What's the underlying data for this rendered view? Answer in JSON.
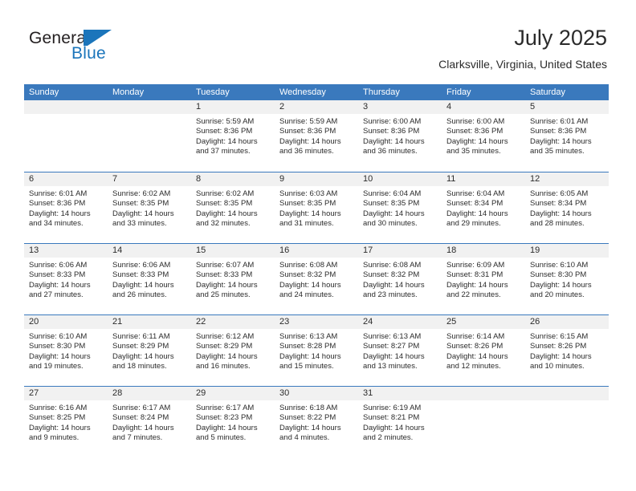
{
  "brand": {
    "word1": "General",
    "word2": "Blue",
    "mark": "flag-triangle-logo"
  },
  "header": {
    "month_title": "July 2025",
    "location": "Clarksville, Virginia, United States"
  },
  "colors": {
    "header_blue": "#3a79bd",
    "brand_blue": "#1b75bb",
    "date_band": "#f1f1f1",
    "text": "#2b2b2b"
  },
  "weekday_headers": [
    "Sunday",
    "Monday",
    "Tuesday",
    "Wednesday",
    "Thursday",
    "Friday",
    "Saturday"
  ],
  "weeks": [
    [
      {
        "date": "",
        "sunrise": "",
        "sunset": "",
        "daylight1": "",
        "daylight2": "",
        "empty": true
      },
      {
        "date": "",
        "sunrise": "",
        "sunset": "",
        "daylight1": "",
        "daylight2": "",
        "empty": true
      },
      {
        "date": "1",
        "sunrise": "Sunrise: 5:59 AM",
        "sunset": "Sunset: 8:36 PM",
        "daylight1": "Daylight: 14 hours",
        "daylight2": "and 37 minutes."
      },
      {
        "date": "2",
        "sunrise": "Sunrise: 5:59 AM",
        "sunset": "Sunset: 8:36 PM",
        "daylight1": "Daylight: 14 hours",
        "daylight2": "and 36 minutes."
      },
      {
        "date": "3",
        "sunrise": "Sunrise: 6:00 AM",
        "sunset": "Sunset: 8:36 PM",
        "daylight1": "Daylight: 14 hours",
        "daylight2": "and 36 minutes."
      },
      {
        "date": "4",
        "sunrise": "Sunrise: 6:00 AM",
        "sunset": "Sunset: 8:36 PM",
        "daylight1": "Daylight: 14 hours",
        "daylight2": "and 35 minutes."
      },
      {
        "date": "5",
        "sunrise": "Sunrise: 6:01 AM",
        "sunset": "Sunset: 8:36 PM",
        "daylight1": "Daylight: 14 hours",
        "daylight2": "and 35 minutes."
      }
    ],
    [
      {
        "date": "6",
        "sunrise": "Sunrise: 6:01 AM",
        "sunset": "Sunset: 8:36 PM",
        "daylight1": "Daylight: 14 hours",
        "daylight2": "and 34 minutes."
      },
      {
        "date": "7",
        "sunrise": "Sunrise: 6:02 AM",
        "sunset": "Sunset: 8:35 PM",
        "daylight1": "Daylight: 14 hours",
        "daylight2": "and 33 minutes."
      },
      {
        "date": "8",
        "sunrise": "Sunrise: 6:02 AM",
        "sunset": "Sunset: 8:35 PM",
        "daylight1": "Daylight: 14 hours",
        "daylight2": "and 32 minutes."
      },
      {
        "date": "9",
        "sunrise": "Sunrise: 6:03 AM",
        "sunset": "Sunset: 8:35 PM",
        "daylight1": "Daylight: 14 hours",
        "daylight2": "and 31 minutes."
      },
      {
        "date": "10",
        "sunrise": "Sunrise: 6:04 AM",
        "sunset": "Sunset: 8:35 PM",
        "daylight1": "Daylight: 14 hours",
        "daylight2": "and 30 minutes."
      },
      {
        "date": "11",
        "sunrise": "Sunrise: 6:04 AM",
        "sunset": "Sunset: 8:34 PM",
        "daylight1": "Daylight: 14 hours",
        "daylight2": "and 29 minutes."
      },
      {
        "date": "12",
        "sunrise": "Sunrise: 6:05 AM",
        "sunset": "Sunset: 8:34 PM",
        "daylight1": "Daylight: 14 hours",
        "daylight2": "and 28 minutes."
      }
    ],
    [
      {
        "date": "13",
        "sunrise": "Sunrise: 6:06 AM",
        "sunset": "Sunset: 8:33 PM",
        "daylight1": "Daylight: 14 hours",
        "daylight2": "and 27 minutes."
      },
      {
        "date": "14",
        "sunrise": "Sunrise: 6:06 AM",
        "sunset": "Sunset: 8:33 PM",
        "daylight1": "Daylight: 14 hours",
        "daylight2": "and 26 minutes."
      },
      {
        "date": "15",
        "sunrise": "Sunrise: 6:07 AM",
        "sunset": "Sunset: 8:33 PM",
        "daylight1": "Daylight: 14 hours",
        "daylight2": "and 25 minutes."
      },
      {
        "date": "16",
        "sunrise": "Sunrise: 6:08 AM",
        "sunset": "Sunset: 8:32 PM",
        "daylight1": "Daylight: 14 hours",
        "daylight2": "and 24 minutes."
      },
      {
        "date": "17",
        "sunrise": "Sunrise: 6:08 AM",
        "sunset": "Sunset: 8:32 PM",
        "daylight1": "Daylight: 14 hours",
        "daylight2": "and 23 minutes."
      },
      {
        "date": "18",
        "sunrise": "Sunrise: 6:09 AM",
        "sunset": "Sunset: 8:31 PM",
        "daylight1": "Daylight: 14 hours",
        "daylight2": "and 22 minutes."
      },
      {
        "date": "19",
        "sunrise": "Sunrise: 6:10 AM",
        "sunset": "Sunset: 8:30 PM",
        "daylight1": "Daylight: 14 hours",
        "daylight2": "and 20 minutes."
      }
    ],
    [
      {
        "date": "20",
        "sunrise": "Sunrise: 6:10 AM",
        "sunset": "Sunset: 8:30 PM",
        "daylight1": "Daylight: 14 hours",
        "daylight2": "and 19 minutes."
      },
      {
        "date": "21",
        "sunrise": "Sunrise: 6:11 AM",
        "sunset": "Sunset: 8:29 PM",
        "daylight1": "Daylight: 14 hours",
        "daylight2": "and 18 minutes."
      },
      {
        "date": "22",
        "sunrise": "Sunrise: 6:12 AM",
        "sunset": "Sunset: 8:29 PM",
        "daylight1": "Daylight: 14 hours",
        "daylight2": "and 16 minutes."
      },
      {
        "date": "23",
        "sunrise": "Sunrise: 6:13 AM",
        "sunset": "Sunset: 8:28 PM",
        "daylight1": "Daylight: 14 hours",
        "daylight2": "and 15 minutes."
      },
      {
        "date": "24",
        "sunrise": "Sunrise: 6:13 AM",
        "sunset": "Sunset: 8:27 PM",
        "daylight1": "Daylight: 14 hours",
        "daylight2": "and 13 minutes."
      },
      {
        "date": "25",
        "sunrise": "Sunrise: 6:14 AM",
        "sunset": "Sunset: 8:26 PM",
        "daylight1": "Daylight: 14 hours",
        "daylight2": "and 12 minutes."
      },
      {
        "date": "26",
        "sunrise": "Sunrise: 6:15 AM",
        "sunset": "Sunset: 8:26 PM",
        "daylight1": "Daylight: 14 hours",
        "daylight2": "and 10 minutes."
      }
    ],
    [
      {
        "date": "27",
        "sunrise": "Sunrise: 6:16 AM",
        "sunset": "Sunset: 8:25 PM",
        "daylight1": "Daylight: 14 hours",
        "daylight2": "and 9 minutes."
      },
      {
        "date": "28",
        "sunrise": "Sunrise: 6:17 AM",
        "sunset": "Sunset: 8:24 PM",
        "daylight1": "Daylight: 14 hours",
        "daylight2": "and 7 minutes."
      },
      {
        "date": "29",
        "sunrise": "Sunrise: 6:17 AM",
        "sunset": "Sunset: 8:23 PM",
        "daylight1": "Daylight: 14 hours",
        "daylight2": "and 5 minutes."
      },
      {
        "date": "30",
        "sunrise": "Sunrise: 6:18 AM",
        "sunset": "Sunset: 8:22 PM",
        "daylight1": "Daylight: 14 hours",
        "daylight2": "and 4 minutes."
      },
      {
        "date": "31",
        "sunrise": "Sunrise: 6:19 AM",
        "sunset": "Sunset: 8:21 PM",
        "daylight1": "Daylight: 14 hours",
        "daylight2": "and 2 minutes."
      },
      {
        "date": "",
        "sunrise": "",
        "sunset": "",
        "daylight1": "",
        "daylight2": "",
        "empty": true
      },
      {
        "date": "",
        "sunrise": "",
        "sunset": "",
        "daylight1": "",
        "daylight2": "",
        "empty": true
      }
    ]
  ]
}
